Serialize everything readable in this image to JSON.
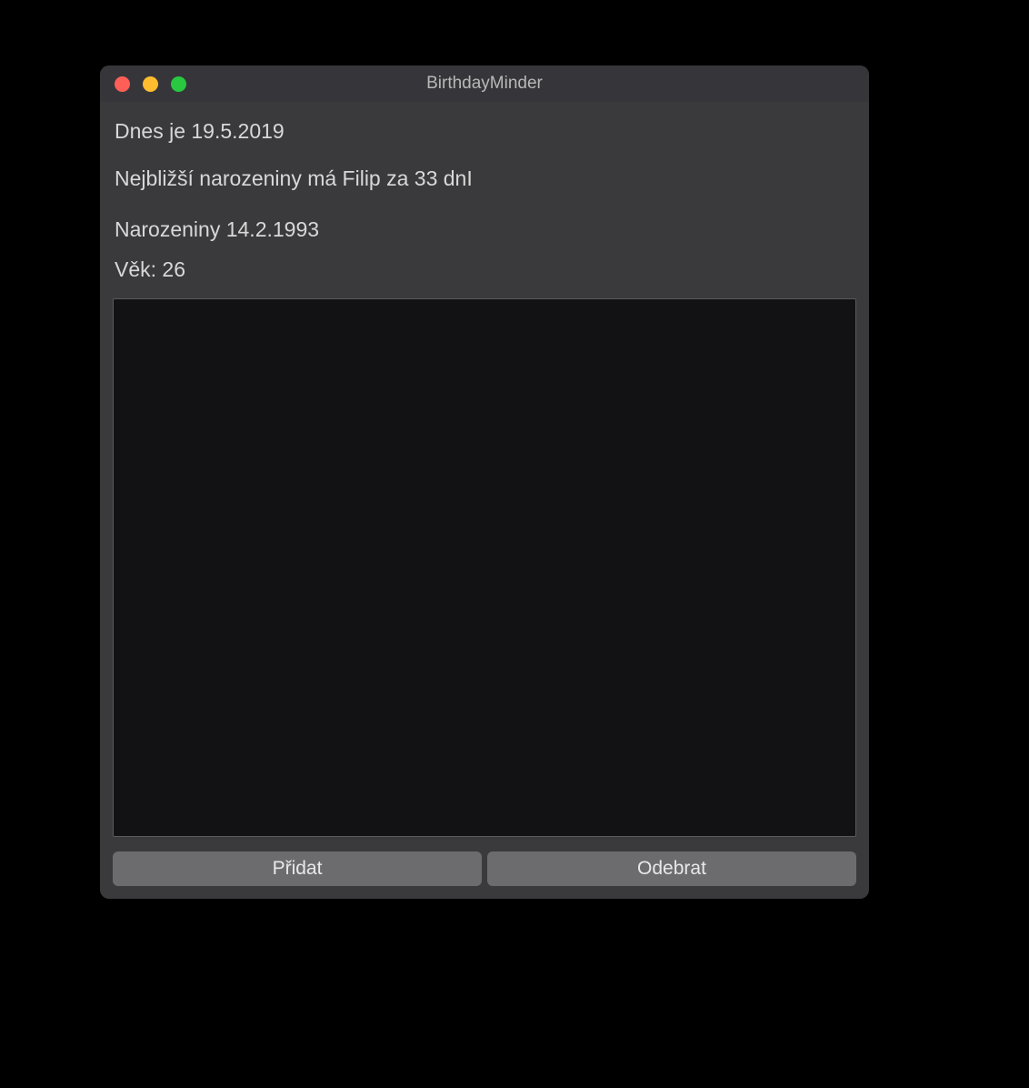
{
  "window": {
    "title": "BirthdayMinder"
  },
  "info": {
    "today_line": "Dnes je 19.5.2019",
    "nearest_line": "Nejbližší narozeniny má Filip za 33 dnI",
    "birthday_line": "Narozeniny 14.2.1993",
    "age_line": "Věk: 26"
  },
  "buttons": {
    "add_label": "Přidat",
    "remove_label": "Odebrat"
  }
}
